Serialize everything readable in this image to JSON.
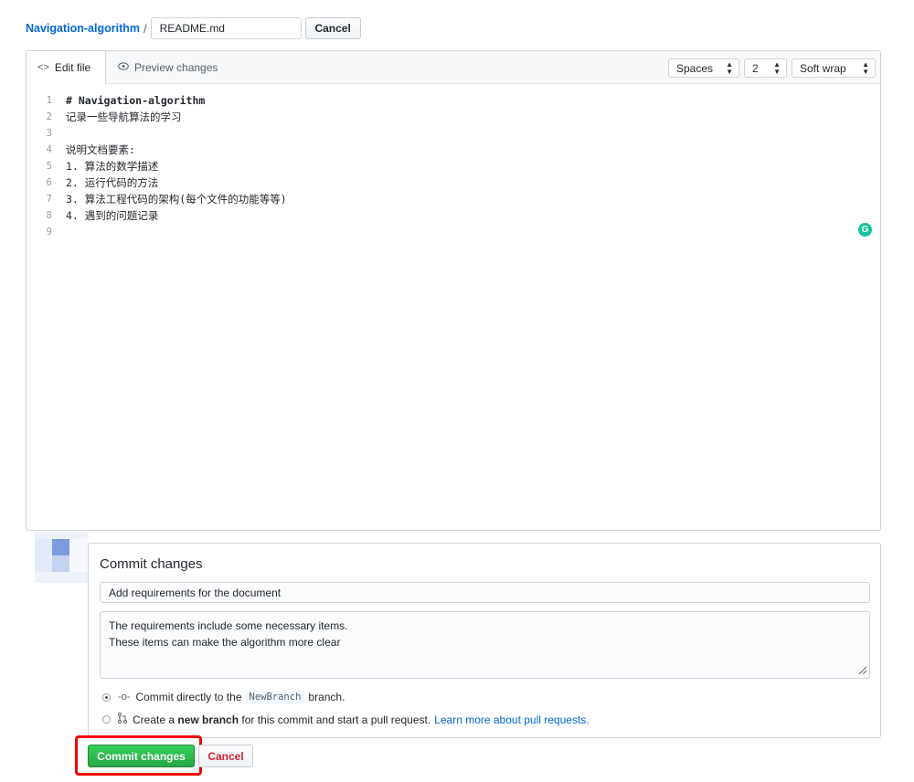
{
  "breadcrumb": {
    "repo": "Navigation-algorithm",
    "separator": "/",
    "filename": "README.md",
    "cancel_label": "Cancel"
  },
  "editor": {
    "tabs": [
      {
        "label": "Edit file",
        "icon": "code-icon"
      },
      {
        "label": "Preview changes",
        "icon": "eye-icon"
      }
    ],
    "indent_mode": "Spaces",
    "indent_size": "2",
    "wrap_mode": "Soft wrap",
    "lines": [
      "# Navigation-algorithm",
      "记录一些导航算法的学习",
      "",
      "说明文档要素:",
      "1. 算法的数学描述",
      "2. 运行代码的方法",
      "3. 算法工程代码的架构(每个文件的功能等等)",
      "4. 遇到的问题记录",
      ""
    ],
    "line_numbers": [
      "1",
      "2",
      "3",
      "4",
      "5",
      "6",
      "7",
      "8",
      "9"
    ],
    "grammarly_badge": "G"
  },
  "commit": {
    "title": "Commit changes",
    "summary_value": "Add requirements for the document",
    "description_line1": "The requirements include some necessary items.",
    "description_line2": "These items can make the algorithm more clear",
    "option_direct_prefix": "Commit directly to the",
    "branch_name": "NewBranch",
    "option_direct_suffix": "branch.",
    "option_new_prefix": "Create a",
    "option_new_bold": "new branch",
    "option_new_suffix": "for this commit and start a pull request.",
    "learn_more": "Learn more about pull requests.",
    "submit_label": "Commit changes",
    "cancel_label": "Cancel"
  },
  "colors": {
    "link": "#0366d6",
    "primary_button": "#28a745",
    "danger_text": "#cb2431",
    "highlight_box": "#f00000"
  }
}
